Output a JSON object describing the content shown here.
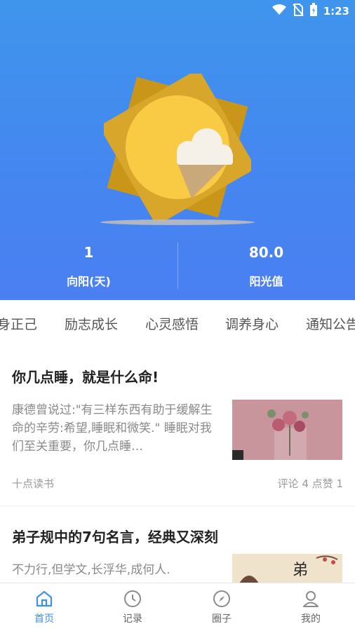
{
  "status_bar": {
    "time": "1:23"
  },
  "stats": [
    {
      "value": "1",
      "label": "向阳(天)"
    },
    {
      "value": "80.0",
      "label": "阳光值"
    }
  ],
  "tabs": [
    "身正己",
    "励志成长",
    "心灵感悟",
    "调养身心",
    "通知公告"
  ],
  "articles": [
    {
      "title": "你几点睡，就是什么命!",
      "excerpt": "康德曾说过:\"有三样东西有助于缓解生命的辛劳:希望,睡眠和微笑.\" 睡眠对我们至关重要，你几点睡…",
      "source": "十点读书",
      "stats": "评论 4   点赞 1"
    },
    {
      "title": "弟子规中的7句名言，经典又深刻",
      "excerpt": "不力行,但学文,长浮华,成何人.",
      "source": "",
      "stats": ""
    }
  ],
  "bottom_nav": [
    {
      "label": "首页",
      "icon": "home-icon",
      "active": true
    },
    {
      "label": "记录",
      "icon": "clock-icon",
      "active": false
    },
    {
      "label": "圈子",
      "icon": "compass-icon",
      "active": false
    },
    {
      "label": "我的",
      "icon": "user-icon",
      "active": false
    }
  ],
  "colors": {
    "accent": "#3d8ff0",
    "header_top": "#3f95ec",
    "header_bottom": "#4a7ff2",
    "sun": "#f7c845",
    "sun_rays": "#d9a41a"
  }
}
